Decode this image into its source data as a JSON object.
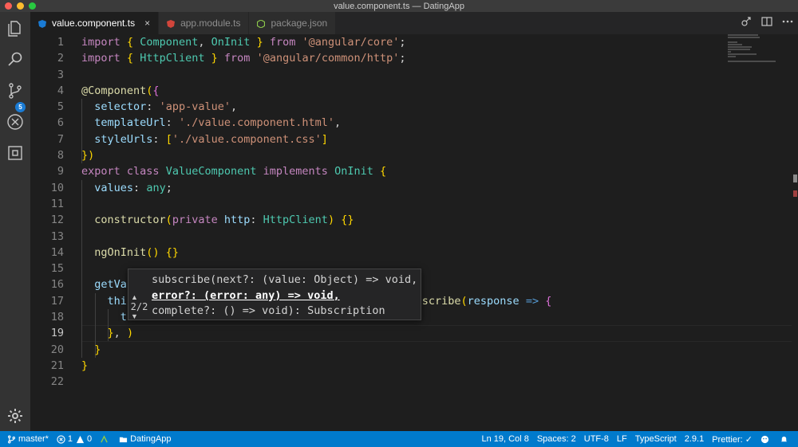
{
  "window": {
    "title": "value.component.ts — DatingApp"
  },
  "activity": {
    "scm_badge": "5"
  },
  "tabs": [
    {
      "label": "value.component.ts",
      "close": "×",
      "icon": "angular-file-icon",
      "active": true
    },
    {
      "label": "app.module.ts",
      "icon": "angular-file-icon",
      "active": false
    },
    {
      "label": "package.json",
      "icon": "node-file-icon",
      "active": false
    }
  ],
  "editor": {
    "line_numbers": [
      "1",
      "2",
      "3",
      "4",
      "5",
      "6",
      "7",
      "8",
      "9",
      "10",
      "11",
      "12",
      "13",
      "14",
      "15",
      "16",
      "17",
      "18",
      "19",
      "20",
      "21",
      "22"
    ],
    "current_line": "19",
    "lines": [
      "import { Component, OnInit } from '@angular/core';",
      "import { HttpClient } from '@angular/common/http';",
      "",
      "@Component({",
      "  selector: 'app-value',",
      "  templateUrl: './value.component.html',",
      "  styleUrls: ['./value.component.css']",
      "})",
      "export class ValueComponent implements OnInit {",
      "  values: any;",
      "",
      "  constructor(private http: HttpClient) {}",
      "",
      "  ngOnInit() {}",
      "",
      "  getVa",
      "    thi",
      "      t",
      "    }, )",
      "  }",
      "}",
      ""
    ],
    "line17_tail": ".subscribe(response => {"
  },
  "hint": {
    "sig_line1": "subscribe(next?: (value: Object) => void,",
    "sig_line2": "error?: (error: any) => void,",
    "sig_line3": "complete?: () => void): Subscription",
    "overload": "2/2"
  },
  "status": {
    "branch": "master*",
    "errors": "1",
    "warnings": "0",
    "folder": "DatingApp",
    "position": "Ln 19, Col 8",
    "spaces": "Spaces: 2",
    "encoding": "UTF-8",
    "eol": "LF",
    "language": "TypeScript",
    "ts_version": "2.9.1",
    "prettier": "Prettier: ✓"
  }
}
